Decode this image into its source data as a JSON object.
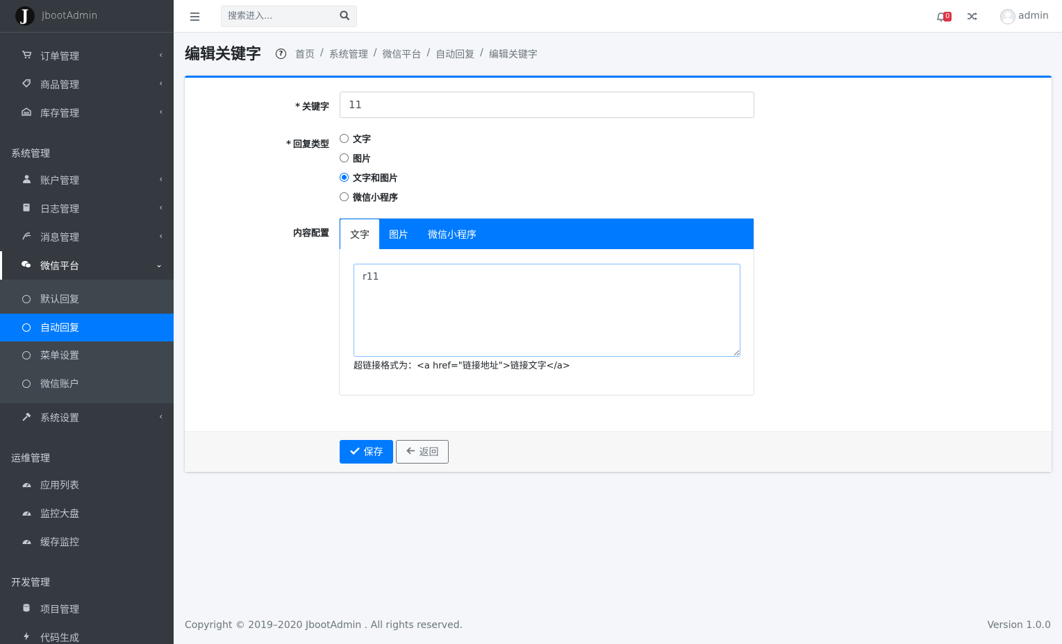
{
  "brand": {
    "logo_letter": "J",
    "name": "JbootAdmin"
  },
  "sidebar": {
    "top_items": [
      {
        "icon": "cart-icon",
        "label": "订单管理"
      },
      {
        "icon": "tag-icon",
        "label": "商品管理"
      },
      {
        "icon": "warehouse-icon",
        "label": "库存管理"
      }
    ],
    "section_system": "系统管理",
    "system_items": [
      {
        "icon": "user-icon",
        "label": "账户管理"
      },
      {
        "icon": "book-icon",
        "label": "日志管理"
      },
      {
        "icon": "broadcast-icon",
        "label": "消息管理"
      },
      {
        "icon": "wechat-icon",
        "label": "微信平台"
      }
    ],
    "wechat_subitems": [
      {
        "label": "默认回复"
      },
      {
        "label": "自动回复"
      },
      {
        "label": "菜单设置"
      },
      {
        "label": "微信账户"
      }
    ],
    "settings_item": {
      "icon": "hammer-icon",
      "label": "系统设置"
    },
    "section_ops": "运维管理",
    "ops_items": [
      {
        "icon": "dashboard-icon",
        "label": "应用列表"
      },
      {
        "icon": "dashboard-icon",
        "label": "监控大盘"
      },
      {
        "icon": "dashboard-icon",
        "label": "缓存监控"
      }
    ],
    "section_dev": "开发管理",
    "dev_items": [
      {
        "icon": "database-icon",
        "label": "项目管理"
      },
      {
        "icon": "bolt-icon",
        "label": "代码生成"
      }
    ]
  },
  "topbar": {
    "search_placeholder": "搜索进入...",
    "notification_count": "0",
    "username": "admin"
  },
  "header": {
    "title": "编辑关键字",
    "breadcrumb": [
      "首页",
      "系统管理",
      "微信平台",
      "自动回复",
      "编辑关键字"
    ]
  },
  "form": {
    "keyword_label": "关键字",
    "keyword_value": "11",
    "reply_type_label": "回复类型",
    "reply_types": [
      "文字",
      "图片",
      "文字和图片",
      "微信小程序"
    ],
    "reply_type_selected": "文字和图片",
    "content_label": "内容配置",
    "tabs": [
      "文字",
      "图片",
      "微信小程序"
    ],
    "active_tab": "文字",
    "text_content": "r11",
    "hint": "超链接格式为：<a href=\"链接地址\">链接文字</a>",
    "save_label": "保存",
    "back_label": "返回",
    "required_mark": "*"
  },
  "footer": {
    "copyright": "Copyright © 2019–2020 JbootAdmin . All rights reserved.",
    "version": "Version 1.0.0"
  },
  "colors": {
    "primary": "#007bff",
    "sidebar": "#343a40",
    "badge": "#dc3545"
  }
}
